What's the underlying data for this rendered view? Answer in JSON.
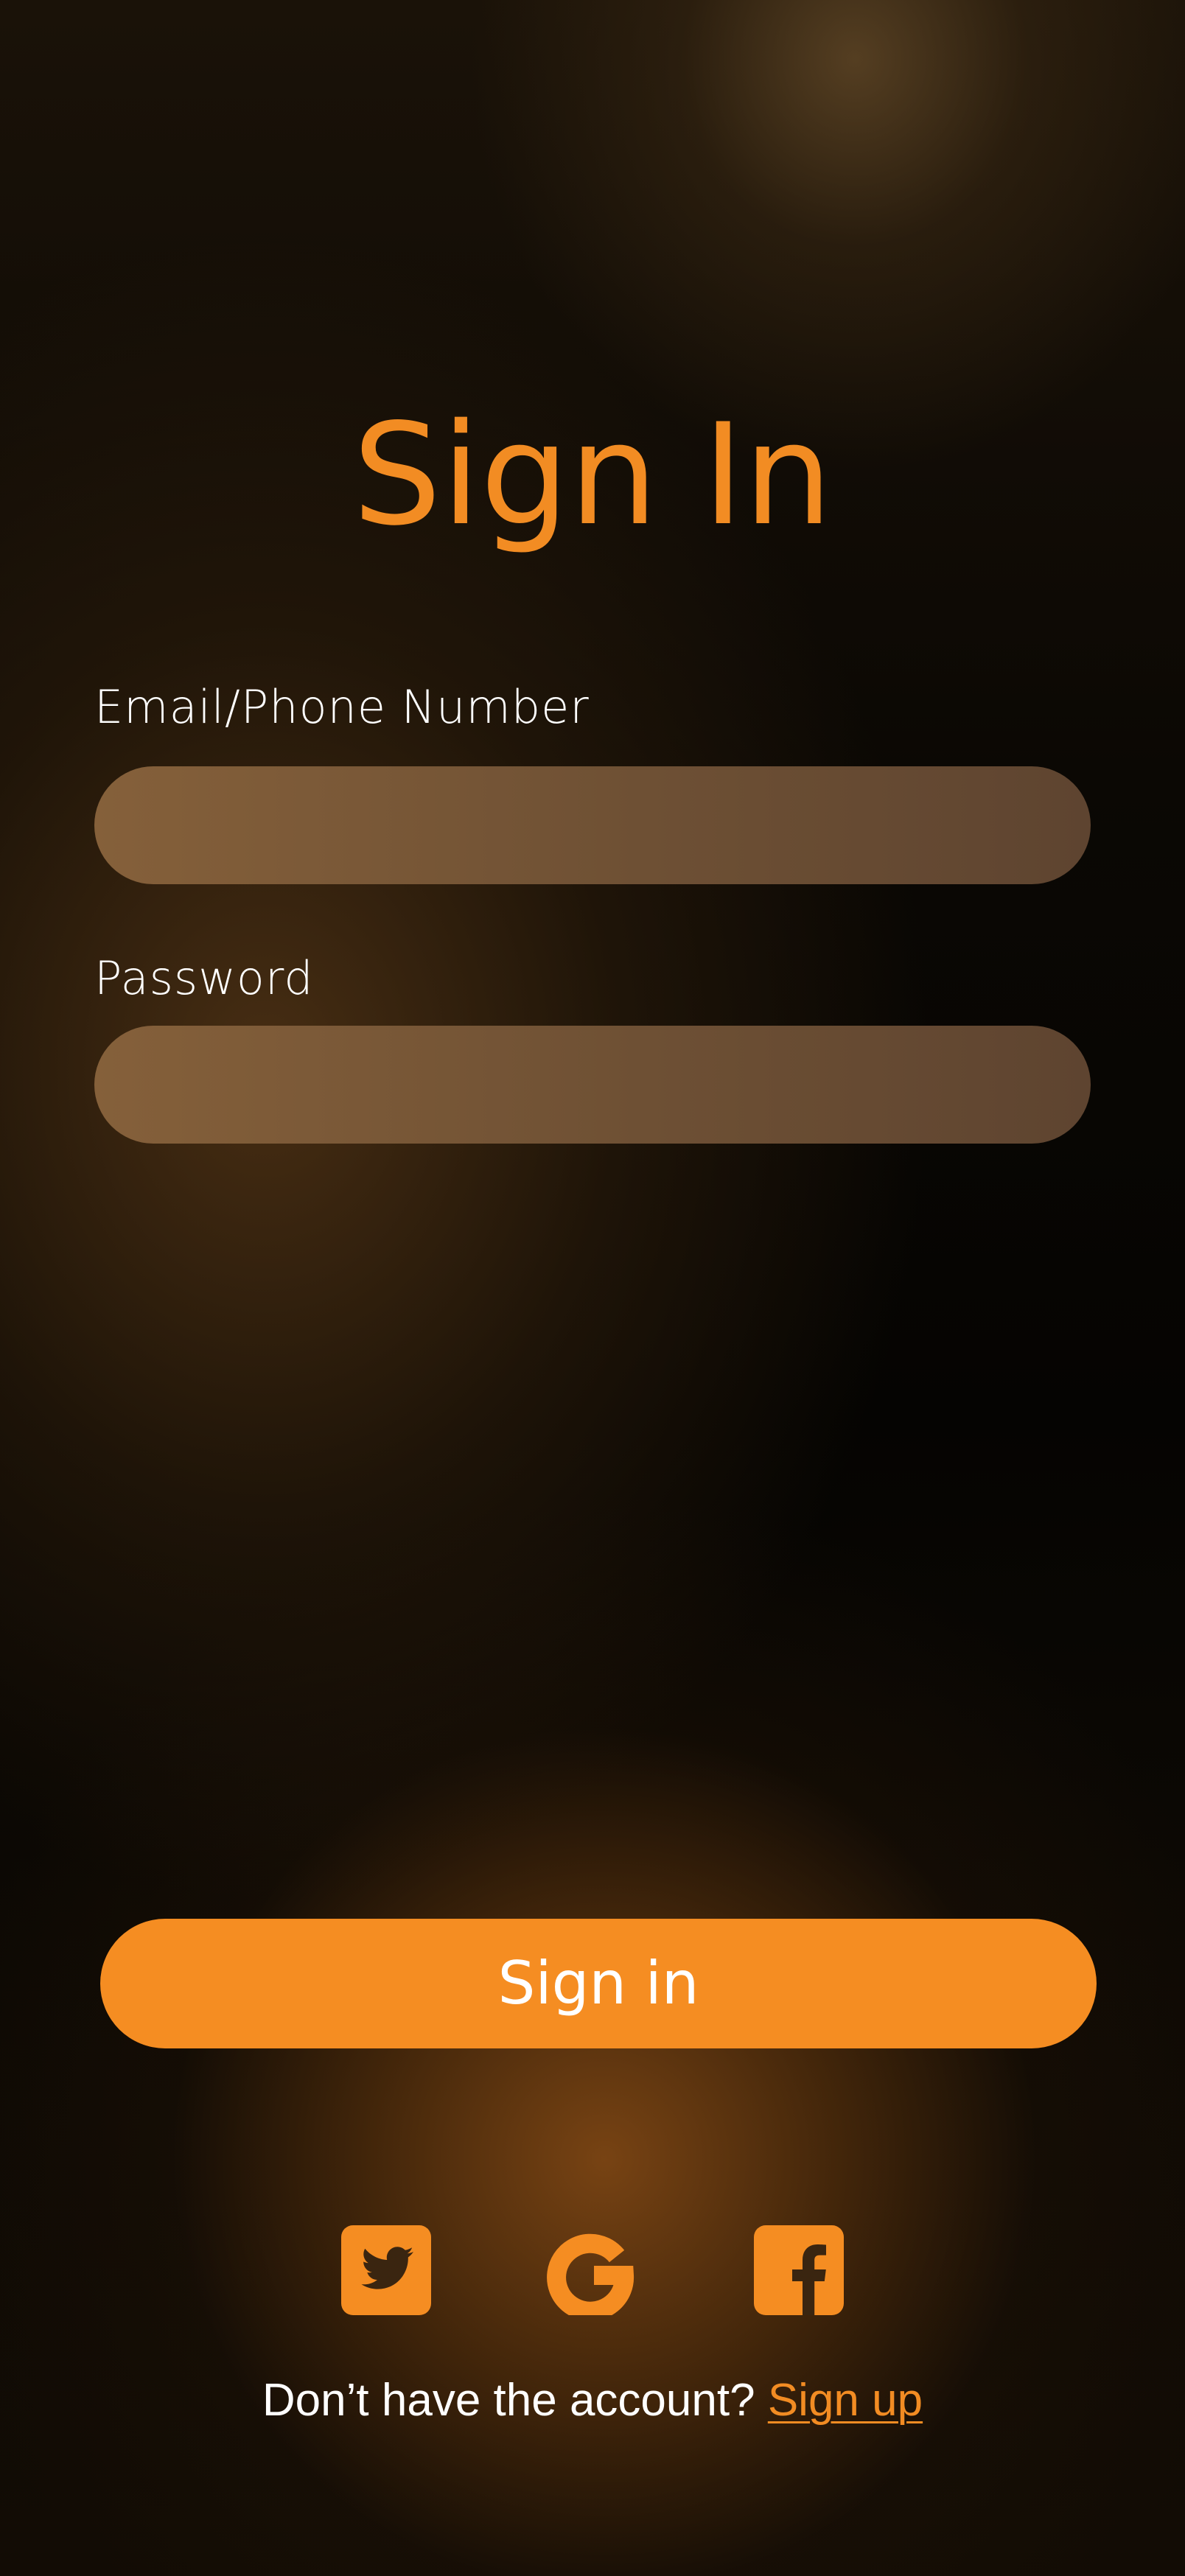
{
  "header": {
    "title": "Sign In"
  },
  "form": {
    "email_label": "Email/Phone Number",
    "email_value": "",
    "password_label": "Password",
    "password_value": ""
  },
  "actions": {
    "signin_label": "Sign in"
  },
  "social": {
    "icons": [
      "twitter-icon",
      "google-icon",
      "facebook-icon"
    ]
  },
  "footer": {
    "prompt": "Don’t have the account?",
    "signup_link": "Sign up"
  },
  "colors": {
    "accent": "#f58d22",
    "input_fill": "#7a5a3a",
    "text": "#ffffff",
    "background": "#000000"
  }
}
